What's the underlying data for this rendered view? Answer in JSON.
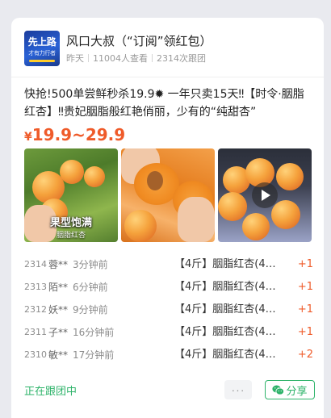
{
  "group": {
    "avatar_line1": "先上路",
    "avatar_line2": "才有力行者",
    "name": "风口大叔（“订阅”领红包）",
    "posted": "昨天",
    "views": "11004人查看",
    "joined": "2314次跟团"
  },
  "product": {
    "title": "快抢!500单尝鲜秒杀19.9✹ 一年只卖15天‼【时令·胭脂红杏】‼贵妃胭脂般红艳俏丽，少有的“纯甜杏”",
    "currency": "¥",
    "price_range": "19.9~29.9",
    "image1_caption": "果型饱满",
    "image1_subcaption": "胭脂红杏",
    "image3_type": "video"
  },
  "orders": [
    {
      "num": "2314",
      "name": "蓉**",
      "time": "3分钟前",
      "product": "【4斤】胭脂红杏(4…",
      "qty": "+1"
    },
    {
      "num": "2313",
      "name": "陌**",
      "time": "6分钟前",
      "product": "【4斤】胭脂红杏(4…",
      "qty": "+1"
    },
    {
      "num": "2312",
      "name": "妖**",
      "time": "9分钟前",
      "product": "【4斤】胭脂红杏(4…",
      "qty": "+1"
    },
    {
      "num": "2311",
      "name": "子**",
      "time": "16分钟前",
      "product": "【4斤】胭脂红杏(4…",
      "qty": "+1"
    },
    {
      "num": "2310",
      "name": "敏**",
      "time": "17分钟前",
      "product": "【4斤】胭脂红杏(4…",
      "qty": "+2"
    }
  ],
  "footer": {
    "status": "正在跟团中",
    "more_label": "···",
    "share_label": "分享"
  },
  "colors": {
    "accent_green": "#2eb36a",
    "price_orange": "#ef5b2a"
  },
  "icons": [
    "wechat-icon",
    "play-icon"
  ]
}
